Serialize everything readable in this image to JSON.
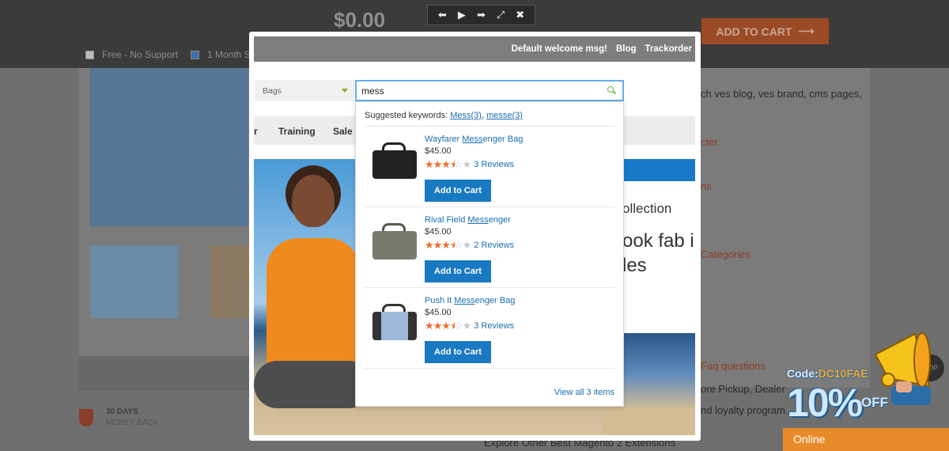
{
  "background": {
    "price": "$0.00",
    "add_to_cart": "ADD TO CART",
    "option_free": "Free - No Support",
    "option_month": "1 Month Su",
    "guarantee_title": "30 DAYS",
    "guarantee_sub": "MONEY BACK",
    "right_text_1": "ch ves blog, ves brand, cms pages,",
    "right_link_1": "cter",
    "right_link_2": "ns",
    "right_link_3": "Categories",
    "right_link_4": "Faq questions",
    "right_text_2": "ore Pickup, Dealer",
    "right_text_3": "nd loyalty program.",
    "explore_text": "Explore Other Best Magento 2 Extensions",
    "top_button": "TOP"
  },
  "promo": {
    "code_label": "Code:",
    "code_value": "DC10FAE",
    "percent": "10%",
    "off": "OFF",
    "online": "Online"
  },
  "lightbox": {
    "welcome": "Default welcome msg!",
    "blog": "Blog",
    "trackorder": "Trackorder",
    "category": "Bags",
    "search_value": "mess",
    "nav": [
      "r",
      "Training",
      "Sale"
    ],
    "hero_line1": "ollection",
    "hero_line2": "ook fab i",
    "hero_line3": "les"
  },
  "dropdown": {
    "suggested_label": "Suggested keywords:",
    "keywords": [
      "Mess(3)",
      "messe(3)"
    ],
    "results": [
      {
        "name_pre": "Wayfarer ",
        "name_match": "Mess",
        "name_post": "enger Bag",
        "price": "$45.00",
        "rating": 3.5,
        "reviews": "3 Reviews",
        "button": "Add to Cart",
        "bag_color": "#222222"
      },
      {
        "name_pre": "Rival Field ",
        "name_match": "Mess",
        "name_post": "enger",
        "price": "$45.00",
        "rating": 3.5,
        "reviews": "2 Reviews",
        "button": "Add to Cart",
        "bag_color": "#777b6e"
      },
      {
        "name_pre": "Push It ",
        "name_match": "Mess",
        "name_post": "enger Bag",
        "price": "$45.00",
        "rating": 3.5,
        "reviews": "3 Reviews",
        "button": "Add to Cart",
        "bag_color": "#9cb7d8"
      }
    ],
    "view_all": "View all 3 items"
  },
  "colors": {
    "accent_blue": "#1979c3",
    "link_blue": "#1a6fb0",
    "star_orange": "#f26c2b"
  }
}
